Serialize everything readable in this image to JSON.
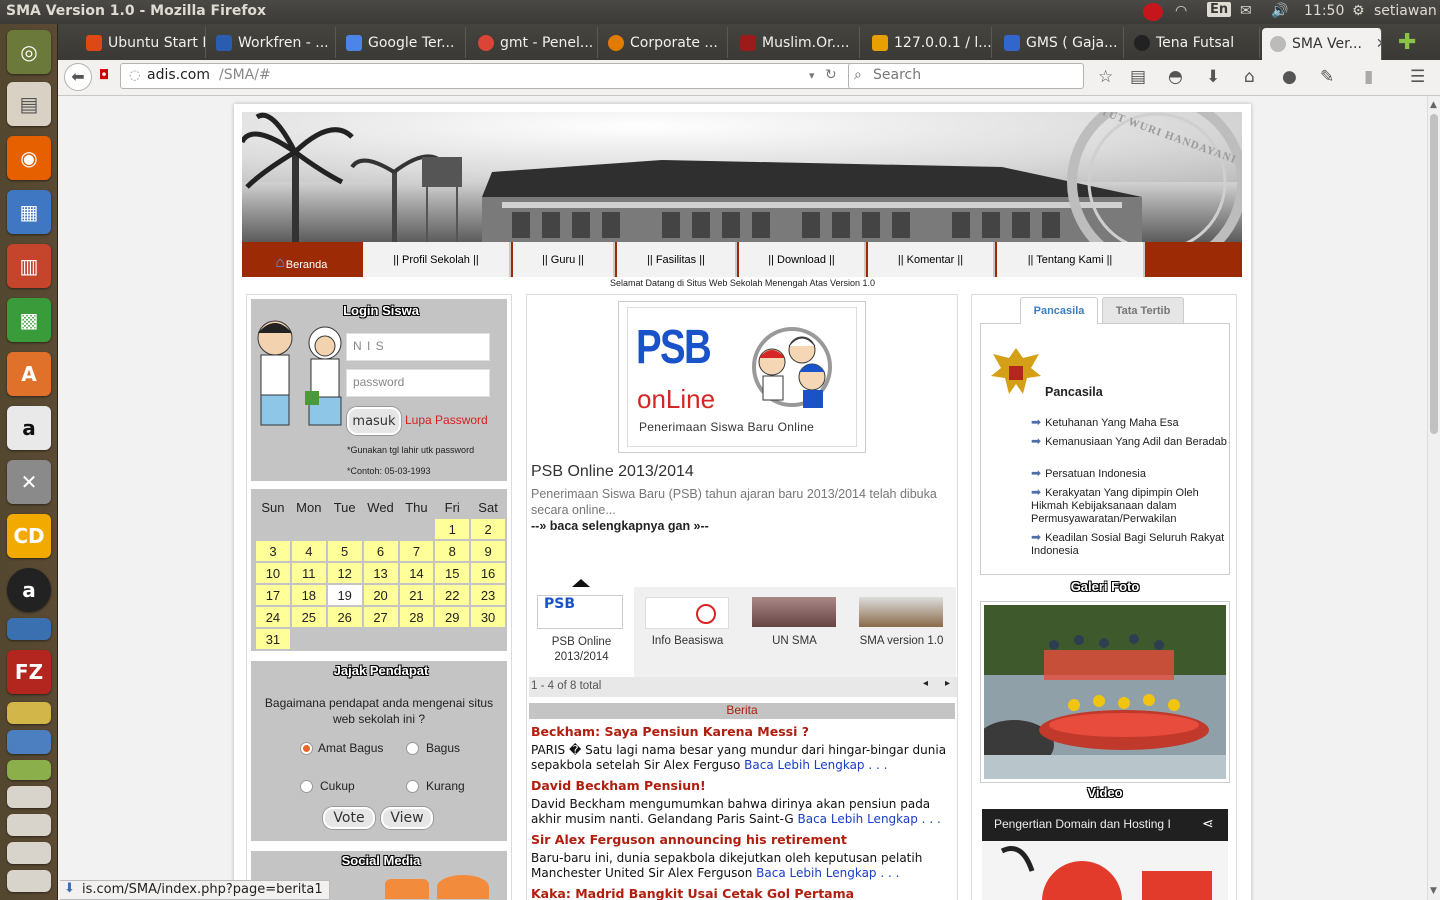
{
  "os": {
    "window_title": "SMA Version 1.0 - Mozilla Firefox",
    "keyboard": "En",
    "clock": "11:50",
    "user": "setiawan"
  },
  "browser": {
    "tabs": [
      {
        "label": "Ubuntu Start P...",
        "icon_color": "#dd4814"
      },
      {
        "label": "Workfren - ...",
        "icon_color": "#2a5db0"
      },
      {
        "label": "Google Ter...",
        "icon_color": "#4a86e8"
      },
      {
        "label": "gmt - Penel...",
        "icon_color": "#db4437"
      },
      {
        "label": "Corporate ...",
        "icon_color": "#e07b00"
      },
      {
        "label": "Muslim.Or....",
        "icon_color": "#9b1b1b"
      },
      {
        "label": "127.0.0.1 / l...",
        "icon_color": "#e8a000"
      },
      {
        "label": "GMS ( Gaja...",
        "icon_color": "#3366cc"
      },
      {
        "label": "Tena Futsal",
        "icon_color": "#222222"
      },
      {
        "label": "SMA Ver...",
        "icon_color": "#bbbbbb"
      }
    ],
    "url_host": "adis.com",
    "url_path": "/SMA/#",
    "search_placeholder": "Search",
    "status_url": "is.com/SMA/index.php?page=berita1"
  },
  "site": {
    "menu": [
      "Beranda",
      "|| Profil Sekolah ||",
      "|| Guru ||",
      "|| Fasilitas ||",
      "|| Download ||",
      "|| Komentar ||",
      "|| Tentang Kami ||"
    ],
    "welcome": "Selamat Datang di Situs Web Sekolah Menengah Atas Version 1.0",
    "header_seal_text": "TUT WURI HANDAYANI",
    "login": {
      "title": "Login Siswa",
      "nis_placeholder": "N I S",
      "password_placeholder": "password",
      "submit": "masuk",
      "forgot": "Lupa Password",
      "note1": "*Gunakan tgl lahir utk password",
      "note2": "*Contoh: 05-03-1993"
    },
    "calendar": {
      "days": [
        "Sun",
        "Mon",
        "Tue",
        "Wed",
        "Thu",
        "Fri",
        "Sat"
      ],
      "weeks": [
        [
          "",
          "",
          "",
          "",
          "",
          "1",
          "2"
        ],
        [
          "3",
          "4",
          "5",
          "6",
          "7",
          "8",
          "9"
        ],
        [
          "10",
          "11",
          "12",
          "13",
          "14",
          "15",
          "16"
        ],
        [
          "17",
          "18",
          "19",
          "20",
          "21",
          "22",
          "23"
        ],
        [
          "24",
          "25",
          "26",
          "27",
          "28",
          "29",
          "30"
        ],
        [
          "31",
          "",
          "",
          "",
          "",
          "",
          ""
        ]
      ],
      "today": "19"
    },
    "poll": {
      "title": "Jajak Pendapat",
      "question": "Bagaimana pendapat anda mengenai situs web sekolah ini ?",
      "options": [
        "Amat Bagus",
        "Bagus",
        "Cukup",
        "Kurang"
      ],
      "selected": "Amat Bagus",
      "vote": "Vote",
      "view": "View"
    },
    "social_title": "Social Media",
    "featured": {
      "logo_big": "PSB",
      "logo_small": "onLine",
      "logo_caption": "Penerimaan Siswa Baru Online",
      "title": "PSB Online 2013/2014",
      "text": "Penerimaan Siswa Baru (PSB) tahun ajaran baru 2013/2014 telah dibuka secara online...",
      "more": "--» baca selengkapnya gan »--"
    },
    "slider": {
      "items": [
        "PSB Online 2013/2014",
        "Info Beasiswa",
        "UN SMA",
        "SMA version 1.0"
      ],
      "count": "1 - 4 of 8 total"
    },
    "news": {
      "title": "Berita",
      "items": [
        {
          "title": "Beckham: Saya Pensiun Karena Messi ?",
          "body": "PARIS � Satu lagi nama besar yang mundur dari hingar-bingar dunia sepakbola setelah Sir Alex Ferguso",
          "link": "Baca Lebih Lengkap . . ."
        },
        {
          "title": "David Beckham Pensiun!",
          "body": "David Beckham mengumumkan bahwa dirinya akan pensiun pada akhir musim nanti. Gelandang Paris Saint-G",
          "link": "Baca Lebih Lengkap . . ."
        },
        {
          "title": "Sir Alex Ferguson announcing his retirement",
          "body": "Baru-baru ini, dunia sepakbola dikejutkan oleh keputusan pelatih Manchester United Sir Alex Ferguson",
          "link": "Baca Lebih Lengkap . . ."
        },
        {
          "title": "Kaka: Madrid Bangkit Usai Cetak Gol Pertama",
          "body": "",
          "link": ""
        }
      ]
    },
    "right": {
      "tabs": [
        "Pancasila",
        "Tata Tertib"
      ],
      "pancasila_title": "Pancasila",
      "principles": [
        "Ketuhanan Yang Maha Esa",
        "Kemanusiaan Yang Adil dan Beradab",
        "Persatuan Indonesia",
        "Kerakyatan Yang dipimpin Oleh Hikmah Kebijaksanaan dalam Permusyawaratan/Perwakilan",
        "Keadilan Sosial Bagi Seluruh Rakyat Indonesia"
      ],
      "gallery_title": "Galeri Foto",
      "video_title": "Video",
      "video_caption": "Pengertian Domain dan Hosting I"
    }
  },
  "colors": {
    "menu_bar": "#9c2a05",
    "news_title": "#b01e0e",
    "link": "#1a3cc8",
    "calendar_day": "#ffff99",
    "panel": "#c4c4c4"
  }
}
